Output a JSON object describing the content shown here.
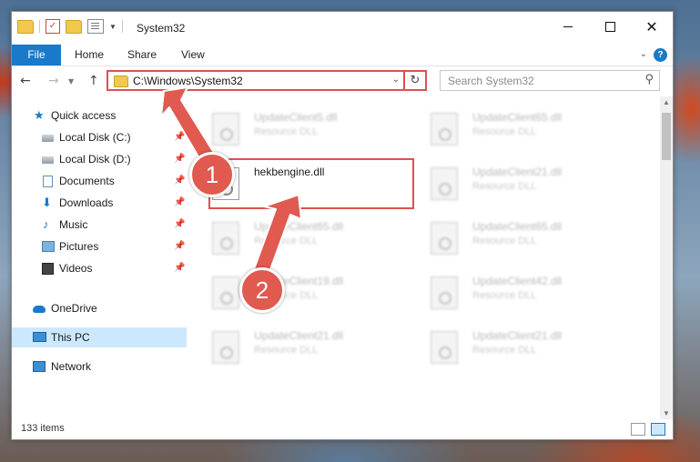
{
  "window": {
    "title": "System32"
  },
  "ribbon": {
    "file": "File",
    "home": "Home",
    "share": "Share",
    "view": "View",
    "expand": "⌄",
    "help": "?"
  },
  "navigation": {
    "address": "C:\\Windows\\System32",
    "search_placeholder": "Search System32"
  },
  "sidebar": {
    "quick_access": "Quick access",
    "local_disk_c": "Local Disk (C:)",
    "local_disk_d": "Local Disk (D:)",
    "documents": "Documents",
    "downloads": "Downloads",
    "music": "Music",
    "pictures": "Pictures",
    "videos": "Videos",
    "onedrive": "OneDrive",
    "this_pc": "This PC",
    "network": "Network"
  },
  "files": {
    "f1_name": "UpdateClient5.dll",
    "f1_type": "Resource DLL",
    "f2_name": "UpdateClient65.dll",
    "f2_type": "Resource DLL",
    "f3_name": "hekbengine.dll",
    "f4_name": "UpdateClient21.dll",
    "f4_type": "Resource DLL",
    "f5_name": "UpdateClient65.dll",
    "f5_type": "Resource DLL",
    "f6_name": "UpdateClient65.dll",
    "f6_type": "Resource DLL",
    "f7_name": "UpdateClient19.dll",
    "f7_type": "Resource DLL",
    "f8_name": "UpdateClient42.dll",
    "f8_type": "Resource DLL",
    "f9_name": "UpdateClient21.dll",
    "f9_type": "Resource DLL",
    "f10_name": "UpdateClient21.dll",
    "f10_type": "Resource DLL"
  },
  "status": {
    "item_count": "133 items"
  },
  "annotations": {
    "step1": "1",
    "step2": "2",
    "accent_color": "#e05a4f"
  }
}
